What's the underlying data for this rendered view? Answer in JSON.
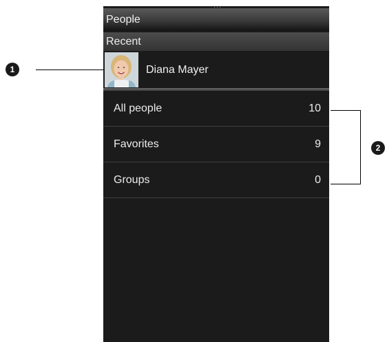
{
  "screen": {
    "title": "People",
    "recent_section": {
      "header": "Recent",
      "contact_name": "Diana Mayer"
    },
    "list": [
      {
        "label": "All people",
        "count": "10"
      },
      {
        "label": "Favorites",
        "count": "9"
      },
      {
        "label": "Groups",
        "count": "0"
      }
    ]
  },
  "callouts": [
    "1",
    "2"
  ]
}
